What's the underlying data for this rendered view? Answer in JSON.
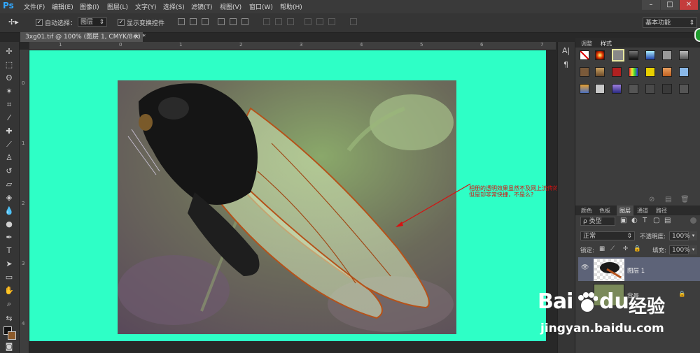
{
  "app": {
    "logo": "Ps"
  },
  "menu": [
    "文件(F)",
    "编辑(E)",
    "图像(I)",
    "图层(L)",
    "文字(Y)",
    "选择(S)",
    "滤镜(T)",
    "视图(V)",
    "窗口(W)",
    "帮助(H)"
  ],
  "window_controls": {
    "minimize": "–",
    "restore": "□",
    "close": "✕"
  },
  "options": {
    "auto_select_label": "自动选择：",
    "auto_select_value": "图层",
    "show_transform_label": "显示变换控件",
    "workspace": "基本功能"
  },
  "document": {
    "tab_title": "3xg01.tif @ 100% (图层 1, CMYK/8#) *",
    "close": "×"
  },
  "rulers": {
    "h": [
      "1",
      "0",
      "1",
      "2",
      "3",
      "4",
      "5",
      "6",
      "7"
    ],
    "v": [
      "0",
      "1",
      "2",
      "3",
      "4"
    ]
  },
  "annotation": {
    "line1": "相册的透明效果虽然不及网上流传的方法",
    "line2": "但是却非常快捷，不是么?"
  },
  "panels": {
    "top_tabs": [
      "调整",
      "样式"
    ],
    "layer_tabs": [
      "颜色",
      "色板",
      "图层",
      "通道",
      "路径"
    ],
    "filter_kind": "ρ 类型",
    "blend_mode": "正常",
    "opacity_label": "不透明度:",
    "opacity_value": "100%",
    "lock_label": "锁定:",
    "fill_label": "填充:",
    "fill_value": "100%",
    "layers": [
      {
        "name": "图层 1"
      },
      {
        "name": "背景"
      }
    ]
  },
  "watermark": {
    "brand": "Bai",
    "brand2": "du",
    "brand3": "经验",
    "url": "jingyan.baidu.com"
  },
  "colors": {
    "canvas": "#2effc6",
    "accent": "#31a8ff",
    "annotation": "#d81010"
  }
}
